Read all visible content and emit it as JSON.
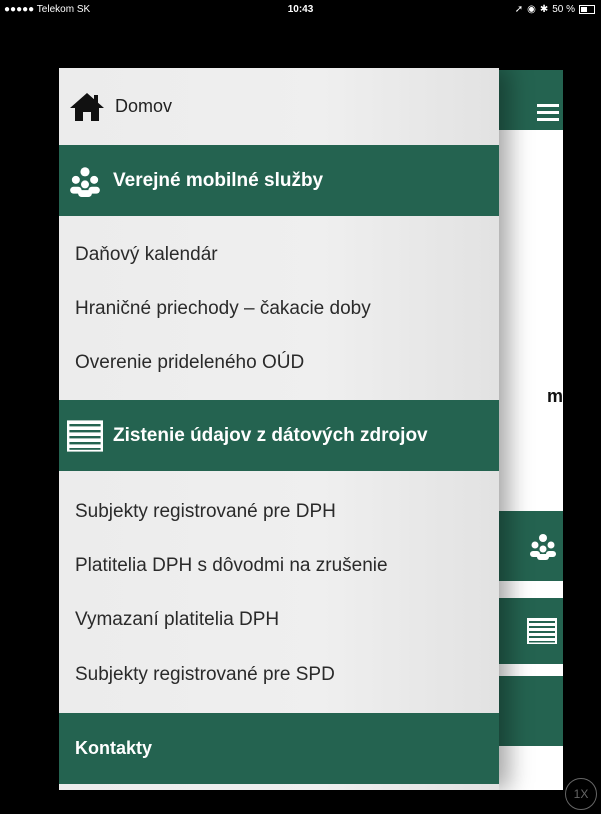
{
  "status_bar": {
    "carrier": "●●●●● Telekom SK",
    "time": "10:43",
    "battery": "50 %",
    "battery_level": 0.5
  },
  "drawer": {
    "home_label": "Domov",
    "sections": [
      {
        "title": "Verejné mobilné služby",
        "icon": "people-group-icon",
        "items": [
          "Daňový kalendár",
          "Hraničné priechody – čakacie doby",
          "Overenie prideleného OÚD"
        ]
      },
      {
        "title": "Zistenie údajov z dátových zdrojov",
        "icon": "list-icon",
        "items": [
          "Subjekty registrované pre DPH",
          "Platitelia DPH s dôvodmi na zrušenie",
          "Vymazaní platitelia DPH",
          "Subjekty registrované pre SPD"
        ]
      },
      {
        "title": "Kontakty"
      }
    ]
  },
  "background_app": {
    "partial_text": "m"
  },
  "zoom_badge": "1X",
  "colors": {
    "accent": "#246350",
    "drawer_bg": "#efefef",
    "text": "#2a2a2a"
  }
}
